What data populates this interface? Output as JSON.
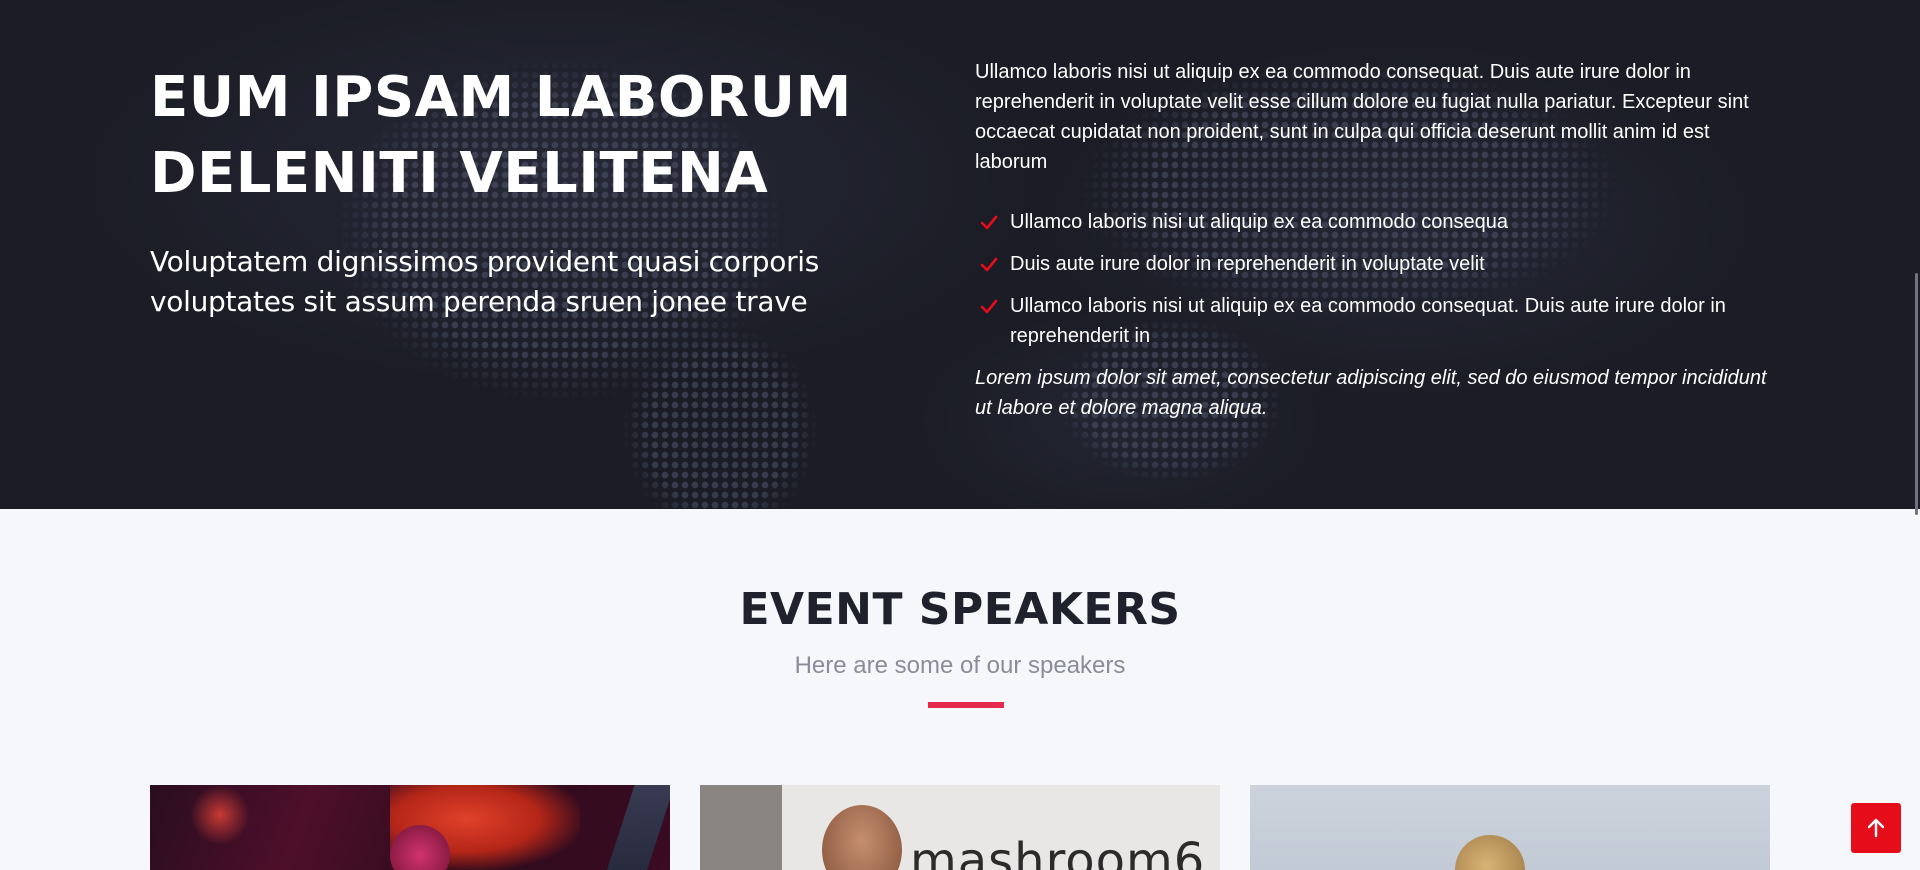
{
  "about": {
    "title_line1": "EUM IPSAM LABORUM",
    "title_line2": "DELENITI VELITENA",
    "subtitle": "Voluptatem dignissimos provident quasi corporis voluptates sit assum perenda sruen jonee trave",
    "paragraph": "Ullamco laboris nisi ut aliquip ex ea commodo consequat. Duis aute irure dolor in reprehenderit in voluptate velit esse cillum dolore eu fugiat nulla pariatur. Excepteur sint occaecat cupidatat non proident, sunt in culpa qui officia deserunt mollit anim id est laborum",
    "checklist": [
      {
        "text": "Ullamco laboris nisi ut aliquip ex ea commodo consequa",
        "icon": "check-icon"
      },
      {
        "text": "Duis aute irure dolor in reprehenderit in voluptate velit",
        "icon": "check-icon"
      },
      {
        "text": "Ullamco laboris nisi ut aliquip ex ea commodo consequat. Duis aute irure dolor in reprehenderit in",
        "icon": "check-icon"
      }
    ],
    "italic_note": "Lorem ipsum dolor sit amet, consectetur adipiscing elit, sed do eiusmod tempor incididunt ut labore et dolore magna aliqua."
  },
  "speakers": {
    "title": "EVENT SPEAKERS",
    "subtitle": "Here are some of our speakers",
    "cards": [
      {
        "photo_text": ""
      },
      {
        "photo_text": "mashroom6"
      },
      {
        "photo_text": ""
      }
    ]
  },
  "scroll_top": {
    "icon": "arrow-up-icon"
  },
  "colors": {
    "accent": "#e4294d",
    "button_red": "#e60d1a",
    "dark_bg": "#1b1c25",
    "light_bg": "#f6f7fa"
  }
}
